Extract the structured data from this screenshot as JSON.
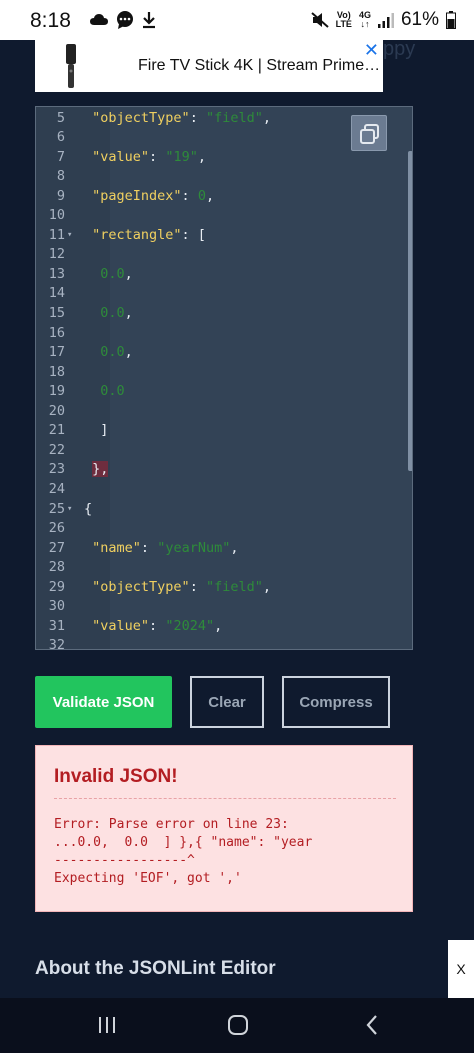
{
  "status_bar": {
    "time": "8:18",
    "lte_top": "Vo)",
    "lte_bottom": "LTE",
    "net_top": "4G",
    "net_bottom": "↓↑",
    "battery": "61%"
  },
  "ad": {
    "text": "Fire TV Stick 4K | Stream Prime…",
    "close": "✕",
    "ghost": "ppy"
  },
  "editor": {
    "lines": [
      {
        "num": "5",
        "fold": "",
        "parts": [
          {
            "t": " "
          },
          {
            "t": "\"objectType\"",
            "c": "k"
          },
          {
            "t": ": "
          },
          {
            "t": "\"field\"",
            "c": "s"
          },
          {
            "t": ","
          }
        ]
      },
      {
        "num": "6",
        "fold": "",
        "parts": []
      },
      {
        "num": "7",
        "fold": "",
        "parts": [
          {
            "t": " "
          },
          {
            "t": "\"value\"",
            "c": "k"
          },
          {
            "t": ": "
          },
          {
            "t": "\"19\"",
            "c": "s"
          },
          {
            "t": ","
          }
        ]
      },
      {
        "num": "8",
        "fold": "",
        "parts": []
      },
      {
        "num": "9",
        "fold": "",
        "parts": [
          {
            "t": " "
          },
          {
            "t": "\"pageIndex\"",
            "c": "k"
          },
          {
            "t": ": "
          },
          {
            "t": "0",
            "c": "n"
          },
          {
            "t": ","
          }
        ]
      },
      {
        "num": "10",
        "fold": "",
        "parts": []
      },
      {
        "num": "11",
        "fold": "▾",
        "parts": [
          {
            "t": " "
          },
          {
            "t": "\"rectangle\"",
            "c": "k"
          },
          {
            "t": ": ["
          }
        ]
      },
      {
        "num": "12",
        "fold": "",
        "parts": []
      },
      {
        "num": "13",
        "fold": "",
        "parts": [
          {
            "t": "  "
          },
          {
            "t": "0.0",
            "c": "n"
          },
          {
            "t": ","
          }
        ]
      },
      {
        "num": "14",
        "fold": "",
        "parts": []
      },
      {
        "num": "15",
        "fold": "",
        "parts": [
          {
            "t": "  "
          },
          {
            "t": "0.0",
            "c": "n"
          },
          {
            "t": ","
          }
        ]
      },
      {
        "num": "16",
        "fold": "",
        "parts": []
      },
      {
        "num": "17",
        "fold": "",
        "parts": [
          {
            "t": "  "
          },
          {
            "t": "0.0",
            "c": "n"
          },
          {
            "t": ","
          }
        ]
      },
      {
        "num": "18",
        "fold": "",
        "parts": []
      },
      {
        "num": "19",
        "fold": "",
        "parts": [
          {
            "t": "  "
          },
          {
            "t": "0.0",
            "c": "n"
          }
        ]
      },
      {
        "num": "20",
        "fold": "",
        "parts": []
      },
      {
        "num": "21",
        "fold": "",
        "parts": [
          {
            "t": "  ]"
          }
        ]
      },
      {
        "num": "22",
        "fold": "",
        "parts": []
      },
      {
        "num": "23",
        "fold": "",
        "parts": [
          {
            "t": " "
          },
          {
            "t": "},",
            "c": "hl"
          }
        ]
      },
      {
        "num": "24",
        "fold": "",
        "parts": []
      },
      {
        "num": "25",
        "fold": "▾",
        "parts": [
          {
            "t": "{"
          }
        ]
      },
      {
        "num": "26",
        "fold": "",
        "parts": []
      },
      {
        "num": "27",
        "fold": "",
        "parts": [
          {
            "t": " "
          },
          {
            "t": "\"name\"",
            "c": "k"
          },
          {
            "t": ": "
          },
          {
            "t": "\"yearNum\"",
            "c": "s"
          },
          {
            "t": ","
          }
        ]
      },
      {
        "num": "28",
        "fold": "",
        "parts": []
      },
      {
        "num": "29",
        "fold": "",
        "parts": [
          {
            "t": " "
          },
          {
            "t": "\"objectType\"",
            "c": "k"
          },
          {
            "t": ": "
          },
          {
            "t": "\"field\"",
            "c": "s"
          },
          {
            "t": ","
          }
        ]
      },
      {
        "num": "30",
        "fold": "",
        "parts": []
      },
      {
        "num": "31",
        "fold": "",
        "parts": [
          {
            "t": " "
          },
          {
            "t": "\"value\"",
            "c": "k"
          },
          {
            "t": ": "
          },
          {
            "t": "\"2024\"",
            "c": "s"
          },
          {
            "t": ","
          }
        ]
      },
      {
        "num": "32",
        "fold": "",
        "parts": []
      }
    ]
  },
  "buttons": {
    "validate": "Validate JSON",
    "clear": "Clear",
    "compress": "Compress"
  },
  "result": {
    "title": "Invalid JSON!",
    "message": "Error: Parse error on line 23:\n...0.0,  0.0  ] },{ \"name\": \"year\n-----------------^\nExpecting 'EOF', got ','"
  },
  "about": {
    "heading": "About the JSONLint Editor"
  },
  "side_tab": {
    "label": "X"
  },
  "colors": {
    "page_bg": "#0f1a2e",
    "validate_green": "#22c55e",
    "error_red": "#b31d22",
    "error_bg": "#fde1e2"
  }
}
